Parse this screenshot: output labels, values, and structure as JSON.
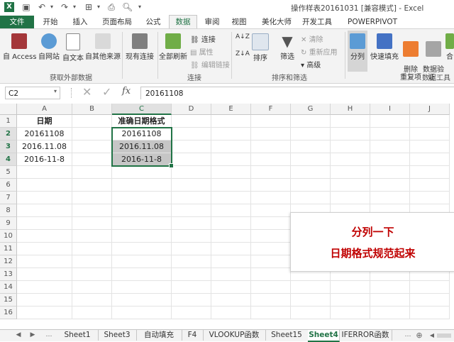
{
  "window": {
    "title": "操作样表20161031  [兼容模式] - Excel"
  },
  "quick_access": [
    "excel-logo",
    "save",
    "undo",
    "redo",
    "form",
    "preview"
  ],
  "ribbon_tabs": [
    "文件",
    "开始",
    "插入",
    "页面布局",
    "公式",
    "数据",
    "审阅",
    "视图",
    "美化大师",
    "开发工具",
    "POWERPIVOT"
  ],
  "active_tab": "数据",
  "ribbon": {
    "get_external": {
      "label": "获取外部数据",
      "buttons": [
        "自 Access",
        "自网站",
        "自文本",
        "自其他来源"
      ]
    },
    "existing_conn": "现有连接",
    "connections": {
      "label": "连接",
      "refresh_all": "全部刷新",
      "items": [
        "连接",
        "属性",
        "编辑链接"
      ]
    },
    "sort_filter": {
      "label": "排序和筛选",
      "sort": "排序",
      "filter": "筛选",
      "items": [
        "清除",
        "重新应用",
        "高级"
      ]
    },
    "data_tools": {
      "label": "数据工具",
      "buttons": [
        "分列",
        "快速填充",
        "删除\n重复项",
        "数据验\n证 ·",
        "合"
      ]
    }
  },
  "formula_bar": {
    "name_box": "C2",
    "fx": "fx",
    "value": "20161108"
  },
  "columns": [
    "A",
    "B",
    "C",
    "D",
    "E",
    "F",
    "G",
    "H",
    "I",
    "J"
  ],
  "rows": [
    "1",
    "2",
    "3",
    "4",
    "5",
    "6",
    "7",
    "8",
    "9",
    "10",
    "11",
    "12",
    "13",
    "14",
    "15",
    "16"
  ],
  "cells": {
    "A1": "日期",
    "A2": "20161108",
    "A3": "2016.11.08",
    "A4": "2016-11-8",
    "C1": "准确日期格式",
    "C2": "20161108",
    "C3": "2016.11.08",
    "C4": "2016-11-8"
  },
  "annotation": {
    "line1": "分列一下",
    "line2": "日期格式规范起来"
  },
  "sheet_tabs": [
    "Sheet1",
    "Sheet3",
    "自动填充",
    "F4",
    "VLOOKUP函数",
    "Sheet15",
    "Sheet4",
    "IFERROR函数"
  ],
  "active_sheet": "Sheet4",
  "sheet_nav": [
    "◀",
    "▶",
    "…",
    "…",
    "⊕"
  ],
  "colors": {
    "accent": "#217346",
    "note_text": "#c00000",
    "selection_fill": "#c6c6c6"
  }
}
